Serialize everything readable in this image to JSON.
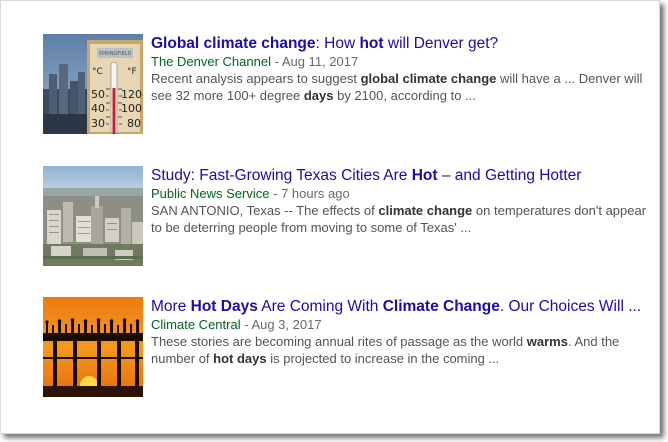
{
  "results": [
    {
      "image_icon": "thermometer-photo",
      "title": [
        {
          "text": "Global climate change",
          "bold": true
        },
        {
          "text": ": How ",
          "bold": false
        },
        {
          "text": "hot",
          "bold": true
        },
        {
          "text": " will Denver get?",
          "bold": false
        }
      ],
      "source": "The Denver Channel",
      "separator": " - ",
      "date": "Aug 11, 2017",
      "snippet_lines": [
        [
          {
            "text": "Recent analysis appears to suggest ",
            "bold": false
          },
          {
            "text": "global climate change",
            "bold": true
          },
          {
            "text": " will have a ... Denver will",
            "bold": false
          }
        ],
        [
          {
            "text": "see 32 more 100+ degree ",
            "bold": false
          },
          {
            "text": "days",
            "bold": true
          },
          {
            "text": " by 2100, according to ...",
            "bold": false
          }
        ]
      ],
      "thermometer": {
        "celsius_label": "°C",
        "fahrenheit_label": "°F",
        "brand": "SPRINGFIELD",
        "c_ticks": [
          "50",
          "40",
          "30"
        ],
        "f_ticks": [
          "120",
          "100",
          "80"
        ]
      }
    },
    {
      "image_icon": "city-aerial-photo",
      "title": [
        {
          "text": "Study: Fast-Growing Texas Cities Are ",
          "bold": false
        },
        {
          "text": "Hot",
          "bold": true
        },
        {
          "text": " – and Getting Hotter",
          "bold": false
        }
      ],
      "source": "Public News Service",
      "separator": " - ",
      "date": "7 hours ago",
      "snippet_lines": [
        [
          {
            "text": "SAN ANTONIO, Texas -- The effects of ",
            "bold": false
          },
          {
            "text": "climate change",
            "bold": true
          },
          {
            "text": " on temperatures don't appear",
            "bold": false
          }
        ],
        [
          {
            "text": "to be deterring people from moving to some of Texas' ...",
            "bold": false
          }
        ]
      ]
    },
    {
      "image_icon": "sunset-pier-photo",
      "title": [
        {
          "text": "More ",
          "bold": false
        },
        {
          "text": "Hot Days",
          "bold": true
        },
        {
          "text": " Are Coming With ",
          "bold": false
        },
        {
          "text": "Climate Change",
          "bold": true
        },
        {
          "text": ". Our Choices Will ...",
          "bold": false
        }
      ],
      "source": "Climate Central",
      "separator": " - ",
      "date": "Aug 3, 2017",
      "snippet_lines": [
        [
          {
            "text": "These stories are becoming annual rites of passage as the world ",
            "bold": false
          },
          {
            "text": "warms",
            "bold": true
          },
          {
            "text": ". And the",
            "bold": false
          }
        ],
        [
          {
            "text": "number of ",
            "bold": false
          },
          {
            "text": "hot days",
            "bold": true
          },
          {
            "text": " is projected to increase in the coming ...",
            "bold": false
          }
        ]
      ]
    }
  ]
}
